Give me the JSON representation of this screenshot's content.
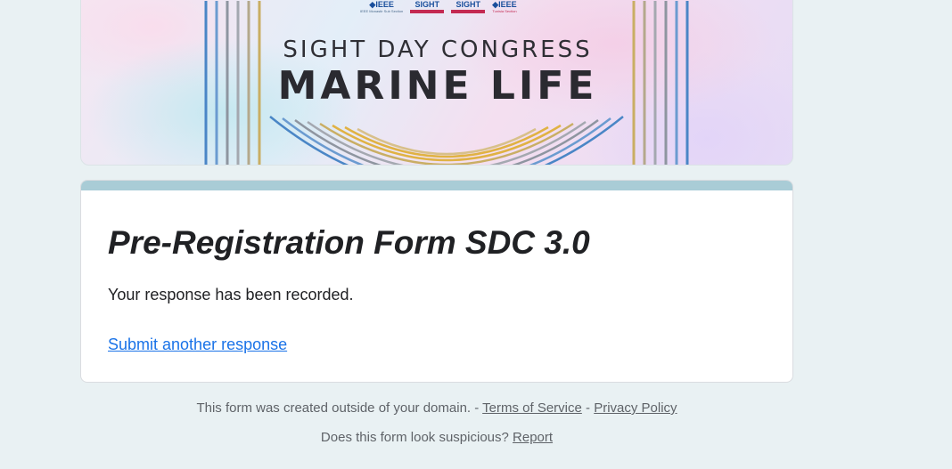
{
  "banner": {
    "logo_1": "◆IEEE",
    "logo_1_sub": "IEEE Monastir Sub Section",
    "logo_2": "SIGHT",
    "logo_3": "SIGHT",
    "logo_4": "◆IEEE",
    "logo_4_sub": "Tunisia Section",
    "congress_text": "SIGHT DAY CONGRESS",
    "theme_text": "MARINE LIFE",
    "colors": {
      "arc_blue": "#4a86c6",
      "arc_gold": "#e0b243",
      "arc_gray": "#8e95a0"
    }
  },
  "card": {
    "title": "Pre-Registration Form SDC 3.0",
    "message": "Your response has been recorded.",
    "submit_another_label": "Submit another response",
    "accent_color": "#a9ccd6"
  },
  "footer": {
    "domain_notice": "This form was created outside of your domain. -",
    "separator": "-",
    "terms_label": "Terms of Service",
    "privacy_label": "Privacy Policy",
    "suspicious_question": "Does this form look suspicious?",
    "report_label": "Report"
  }
}
